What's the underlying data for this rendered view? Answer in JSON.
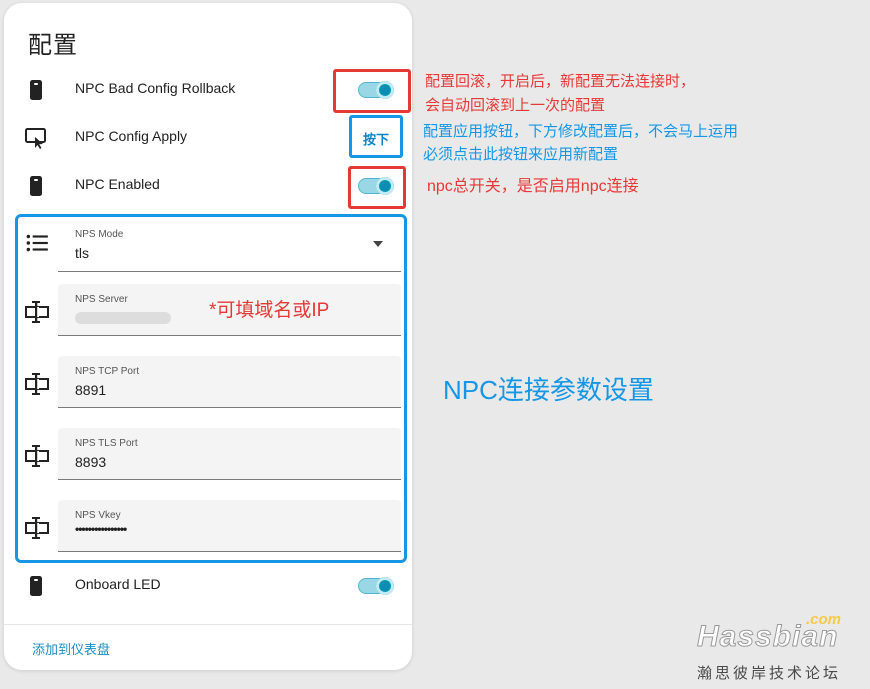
{
  "card": {
    "title": "配置"
  },
  "rows": {
    "rollback": {
      "label": "NPC Bad Config Rollback",
      "on": true
    },
    "apply": {
      "label": "NPC Config Apply",
      "button": "按下"
    },
    "enabled": {
      "label": "NPC Enabled",
      "on": true
    },
    "onboard_led": {
      "label": "Onboard LED",
      "on": true
    }
  },
  "fields": {
    "mode": {
      "label": "NPS Mode",
      "value": "tls"
    },
    "server": {
      "label": "NPS Server",
      "value": ""
    },
    "tcp_port": {
      "label": "NPS TCP Port",
      "value": "8891"
    },
    "tls_port": {
      "label": "NPS TLS Port",
      "value": "8893"
    },
    "vkey": {
      "label": "NPS Vkey",
      "value": "••••••••••••••••"
    }
  },
  "footer": {
    "link": "添加到仪表盘"
  },
  "annotations": {
    "rollback_line1": "配置回滚，开启后，新配置无法连接时，",
    "rollback_line2": "会自动回滚到上一次的配置",
    "apply_line1": "配置应用按钮，下方修改配置后，不会马上运用",
    "apply_line2": "必须点击此按钮来应用新配置",
    "enabled": "npc总开关，是否启用npc连接",
    "server_hint": "*可填域名或IP",
    "params": "NPC连接参数设置"
  },
  "watermark": {
    "brand": "Hassbian",
    "domain": ".com",
    "tagline": "瀚思彼岸技术论坛"
  },
  "colors": {
    "accent": "#039bbd",
    "annotation_red": "#e53935",
    "annotation_blue": "#1597e6"
  }
}
